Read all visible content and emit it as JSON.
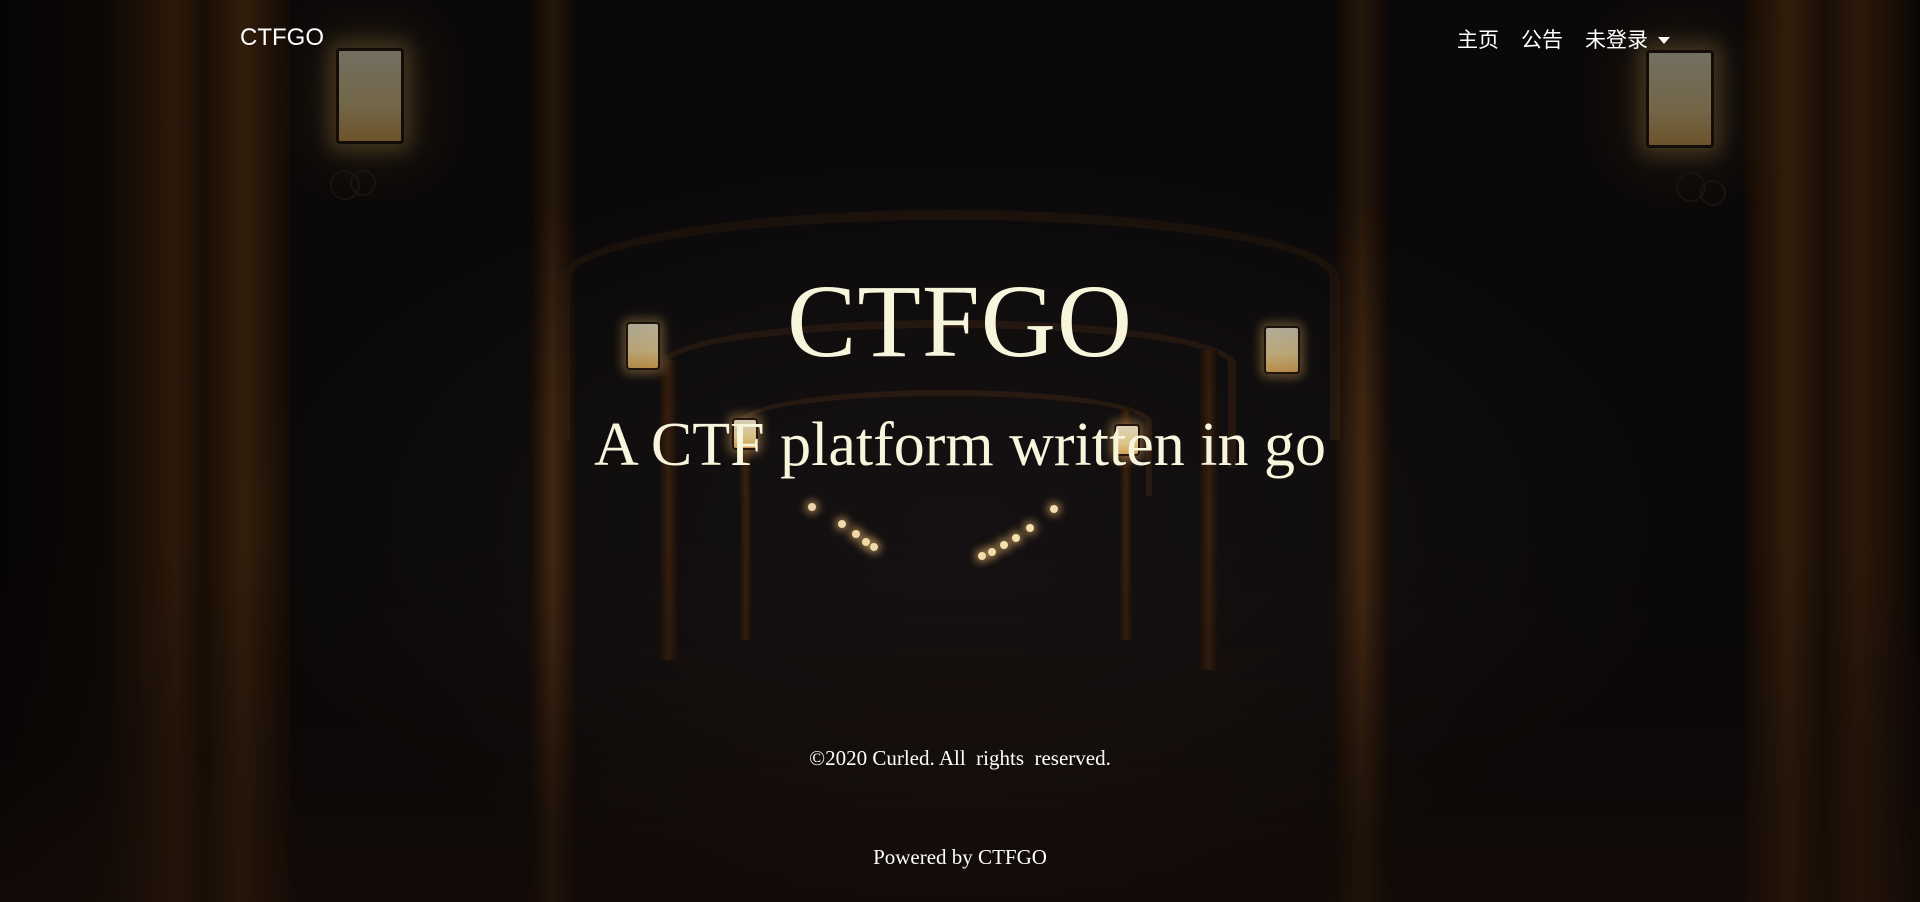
{
  "navbar": {
    "brand": "CTFGO",
    "links": {
      "home": "主页",
      "announcements": "公告",
      "account_dropdown": "未登录"
    }
  },
  "hero": {
    "title": "CTFGO",
    "subtitle": "A CTF platform written in go"
  },
  "footer": {
    "copyright": "©2020 Curled. All  rights  reserved.",
    "powered_by": "Powered by CTFGO"
  },
  "theme": {
    "hero_text_color": "#f7f5dc",
    "nav_text_color": "#ffffff",
    "background": "#151112"
  },
  "icons": {
    "dropdown": "caret-down-icon"
  }
}
